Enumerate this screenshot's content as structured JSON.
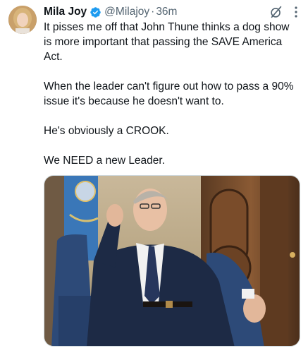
{
  "tweet": {
    "author_name": "Mila Joy",
    "handle": "@Milajoy",
    "separator": "·",
    "time": "36m",
    "verified": true,
    "paragraphs": [
      "It pisses me off that John Thune thinks a dog show is more important that passing the SAVE America Act.",
      "When the leader can't figure out how to pass a 90% issue it's because he doesn't want to.",
      "He's obviously a CROOK.",
      "We NEED a new Leader."
    ]
  },
  "colors": {
    "verified_badge": "#1d9bf0",
    "secondary_text": "#536471",
    "primary_text": "#0f1419"
  },
  "icons": {
    "grok": "grok-icon",
    "more": "more-icon",
    "verified": "verified-badge-icon"
  }
}
